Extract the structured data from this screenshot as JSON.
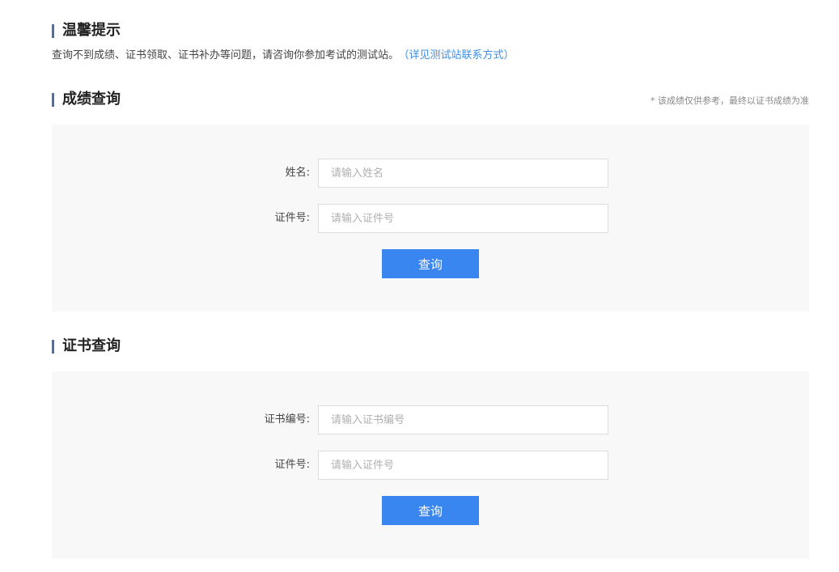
{
  "tips": {
    "title": "温馨提示",
    "text": "查询不到成绩、证书领取、证书补办等问题，请咨询你参加考试的测试站。",
    "link": "（详见测试站联系方式）"
  },
  "score_query": {
    "title": "成绩查询",
    "note": "* 该成绩仅供参考，最终以证书成绩为准",
    "name_label": "姓名:",
    "name_placeholder": "请输入姓名",
    "id_label": "证件号:",
    "id_placeholder": "请输入证件号",
    "button_label": "查询"
  },
  "cert_query": {
    "title": "证书查询",
    "cert_no_label": "证书编号:",
    "cert_no_placeholder": "请输入证书编号",
    "id_label": "证件号:",
    "id_placeholder": "请输入证件号",
    "button_label": "查询"
  }
}
